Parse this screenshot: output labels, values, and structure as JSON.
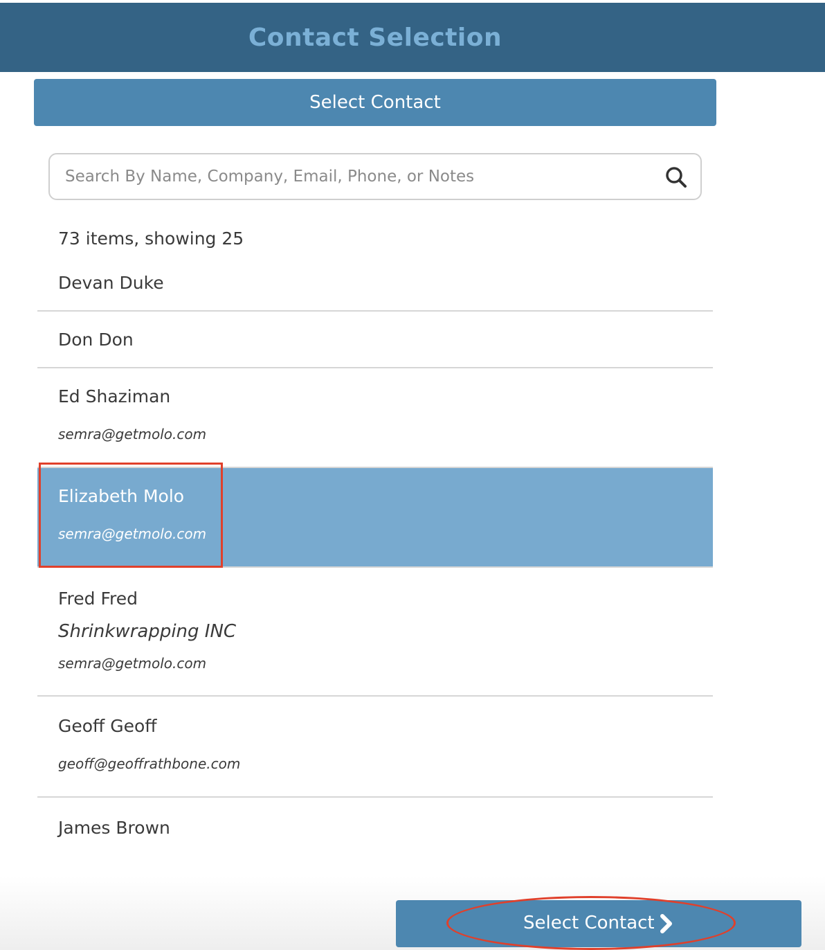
{
  "header": {
    "title": "Contact Selection"
  },
  "select_bar": {
    "label": "Select Contact"
  },
  "search": {
    "placeholder": "Search By Name, Company, Email, Phone, or Notes",
    "value": ""
  },
  "list": {
    "count_text": "73 items, showing 25",
    "items": [
      {
        "name": "Devan Duke"
      },
      {
        "name": "Don Don"
      },
      {
        "name": "Ed Shaziman",
        "email": "semra@getmolo.com"
      },
      {
        "name": "Elizabeth Molo",
        "email": "semra@getmolo.com",
        "selected": true
      },
      {
        "name": "Fred Fred",
        "company": "Shrinkwrapping INC",
        "email": "semra@getmolo.com"
      },
      {
        "name": "Geoff Geoff",
        "email": "geoff@geoffrathbone.com"
      },
      {
        "name": "James Brown"
      }
    ]
  },
  "footer": {
    "button_label": "Select Contact",
    "button_icon": "chevron-right-icon"
  },
  "colors": {
    "header_bg": "#346385",
    "header_title": "#7bb0d6",
    "accent": "#4d87b0",
    "selected_bg": "#78aacf",
    "annotation": "#e0402b"
  }
}
